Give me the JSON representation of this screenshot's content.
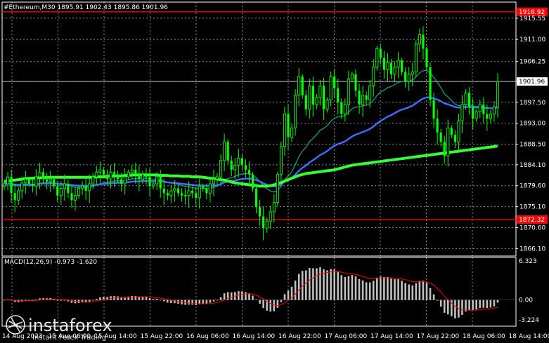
{
  "header": {
    "title": "#Ethereum,M30  1895.91 1902.43 1895.86 1901.96",
    "macd_label": "MACD(12,26,9) -0.973 -1.620"
  },
  "logo": {
    "name": "instaforex",
    "tagline": "Instant Forex Trading"
  },
  "colors": {
    "background": "#000000",
    "grid": "#ffffff",
    "bull_candle": "#00ff00",
    "bear_candle": "#00ff00",
    "ma_fast": "#1f8f7a",
    "ma_mid": "#3f6fff",
    "ma_slow": "#33ff33",
    "level_line": "#ff0000",
    "macd_hist": "#c0c0c0",
    "macd_signal": "#ff0000"
  },
  "chart_data": {
    "type": "candlestick",
    "symbol": "#Ethereum",
    "timeframe": "M30",
    "price_axis": {
      "ticks": [
        "1915.55",
        "1911.00",
        "1906.25",
        "1901.96",
        "1897.50",
        "1893.00",
        "1888.50",
        "1884.10",
        "1879.60",
        "1875.10",
        "1870.60",
        "1866.10"
      ],
      "range": [
        1864.5,
        1919.0
      ]
    },
    "time_axis": {
      "ticks": [
        "14 Aug 2023",
        "15 Aug 06:00",
        "15 Aug 14:00",
        "15 Aug 22:00",
        "16 Aug 06:00",
        "16 Aug 14:00",
        "16 Aug 22:00",
        "17 Aug 06:00",
        "17 Aug 14:00",
        "17 Aug 22:00",
        "18 Aug 06:00",
        "18 Aug 14:00"
      ]
    },
    "levels": [
      {
        "label": "1916.92",
        "value": 1916.92
      },
      {
        "label": "1872.32",
        "value": 1872.32
      }
    ],
    "current_price": {
      "label": "1901.96",
      "value": 1901.96
    },
    "close_series": [
      1880.0,
      1881.5,
      1878.0,
      1876.5,
      1878.5,
      1880.2,
      1881.0,
      1880.0,
      1879.5,
      1881.5,
      1882.5,
      1881.0,
      1880.5,
      1881.0,
      1879.5,
      1877.5,
      1879.0,
      1880.0,
      1878.0,
      1876.5,
      1877.5,
      1879.0,
      1879.5,
      1878.5,
      1880.0,
      1881.5,
      1882.5,
      1883.0,
      1882.0,
      1881.0,
      1882.5,
      1882.0,
      1881.0,
      1880.0,
      1881.5,
      1882.5,
      1883.0,
      1882.0,
      1881.0,
      1882.0,
      1881.5,
      1879.5,
      1880.0,
      1881.5,
      1879.0,
      1878.0,
      1877.5,
      1878.5,
      1879.0,
      1878.0,
      1877.5,
      1877.5,
      1878.5,
      1878.0,
      1877.0,
      1879.5,
      1879.0,
      1878.0,
      1880.0,
      1881.0,
      1881.5,
      1885.0,
      1889.0,
      1885.0,
      1883.0,
      1884.0,
      1885.5,
      1884.0,
      1883.0,
      1882.0,
      1879.0,
      1875.0,
      1873.0,
      1870.5,
      1872.0,
      1874.0,
      1876.0,
      1882.0,
      1888.0,
      1895.0,
      1890.0,
      1892.0,
      1899.0,
      1903.0,
      1899.0,
      1896.0,
      1901.0,
      1897.0,
      1898.5,
      1901.0,
      1896.0,
      1898.0,
      1903.0,
      1900.5,
      1897.5,
      1895.0,
      1897.0,
      1902.5,
      1903.5,
      1900.0,
      1897.0,
      1899.0,
      1898.0,
      1901.0,
      1905.0,
      1909.0,
      1907.0,
      1904.5,
      1906.0,
      1903.5,
      1905.0,
      1906.5,
      1904.0,
      1902.0,
      1903.5,
      1904.0,
      1910.0,
      1912.0,
      1909.0,
      1905.0,
      1898.0,
      1894.0,
      1891.0,
      1889.0,
      1886.0,
      1892.0,
      1890.5,
      1889.0,
      1893.5,
      1897.0,
      1899.5,
      1896.5,
      1894.0,
      1895.5,
      1897.0,
      1895.0,
      1894.0,
      1895.0,
      1896.5,
      1901.96
    ],
    "ma_slow_series": [
      1880.5,
      1880.6,
      1880.7,
      1880.8,
      1880.9,
      1881.0,
      1881.1,
      1881.2,
      1881.2,
      1881.3,
      1881.3,
      1881.3,
      1881.4,
      1881.4,
      1881.4,
      1881.4,
      1881.4,
      1881.4,
      1881.4,
      1881.4,
      1881.4,
      1881.4,
      1881.4,
      1881.4,
      1881.4,
      1881.4,
      1881.5,
      1881.5,
      1881.5,
      1881.6,
      1881.6,
      1881.7,
      1881.7,
      1881.7,
      1881.8,
      1881.8,
      1881.9,
      1881.9,
      1881.9,
      1881.9,
      1881.9,
      1881.9,
      1881.9,
      1881.9,
      1881.8,
      1881.8,
      1881.8,
      1881.7,
      1881.7,
      1881.7,
      1881.6,
      1881.6,
      1881.6,
      1881.5,
      1881.5,
      1881.5,
      1881.4,
      1881.3,
      1881.2,
      1881.1,
      1881.0,
      1880.9,
      1880.8,
      1880.6,
      1880.4,
      1880.2,
      1880.1,
      1880.0,
      1879.9,
      1879.8,
      1879.7,
      1879.6,
      1879.5,
      1879.5,
      1879.5,
      1879.6,
      1879.8,
      1880.0,
      1880.3,
      1880.6,
      1880.9,
      1881.2,
      1881.5,
      1881.8,
      1882.0,
      1882.2,
      1882.3,
      1882.4,
      1882.5,
      1882.6,
      1882.7,
      1882.8,
      1882.9,
      1883.0,
      1883.2,
      1883.4,
      1883.6,
      1883.8,
      1884.0,
      1884.1,
      1884.2,
      1884.3,
      1884.4,
      1884.5,
      1884.6,
      1884.7,
      1884.8,
      1884.9,
      1885.0,
      1885.1,
      1885.2,
      1885.3,
      1885.4,
      1885.5,
      1885.6,
      1885.7,
      1885.8,
      1885.9,
      1886.0,
      1886.1,
      1886.2,
      1886.3,
      1886.4,
      1886.5,
      1886.6,
      1886.7,
      1886.8,
      1886.9,
      1887.0,
      1887.1,
      1887.2,
      1887.3,
      1887.4,
      1887.5,
      1887.6,
      1887.7,
      1887.8,
      1887.9,
      1888.0,
      1888.1
    ]
  },
  "macd_data": {
    "scale_ticks": [
      "6.323",
      "0.00",
      "-3.224"
    ],
    "range": [
      -3.224,
      6.323
    ]
  }
}
